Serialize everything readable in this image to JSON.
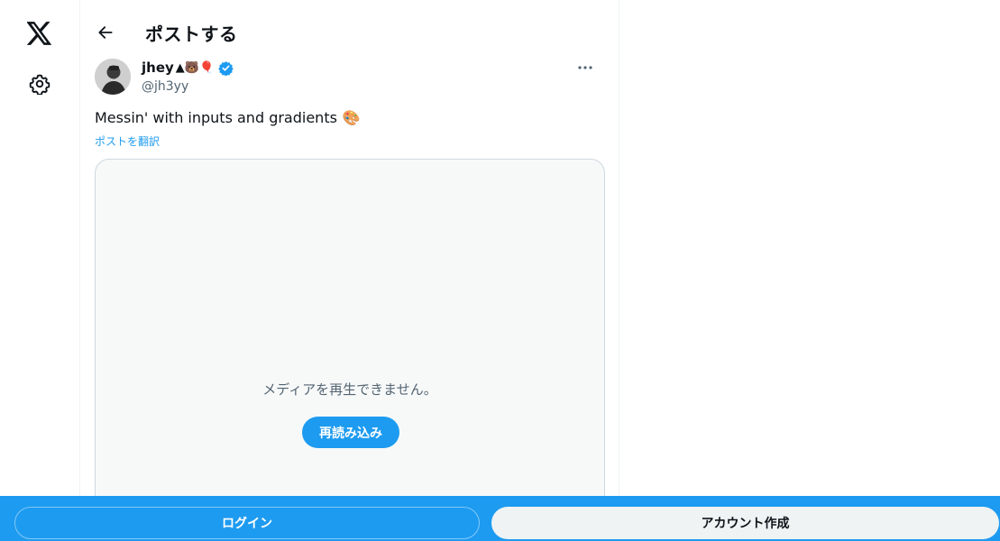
{
  "nav": {
    "logo_icon": "x-logo-icon",
    "settings_icon": "gear-icon"
  },
  "header": {
    "back_icon": "arrow-left-icon",
    "title": "ポストする"
  },
  "post": {
    "author_name": "jhey",
    "name_emojis": "▲🐻🎈",
    "handle": "@jh3yy",
    "text": "Messin' with inputs and gradients",
    "text_emoji": "🎨",
    "translate_link": "ポストを翻訳",
    "media": {
      "message": "メディアを再生できません。",
      "reload_label": "再読み込み"
    }
  },
  "bottom_bar": {
    "login_label": "ログイン",
    "signup_label": "アカウント作成"
  },
  "colors": {
    "accent": "#1d9bf0",
    "text": "#0f1419",
    "secondary_text": "#536471",
    "border": "#cfd9de"
  }
}
